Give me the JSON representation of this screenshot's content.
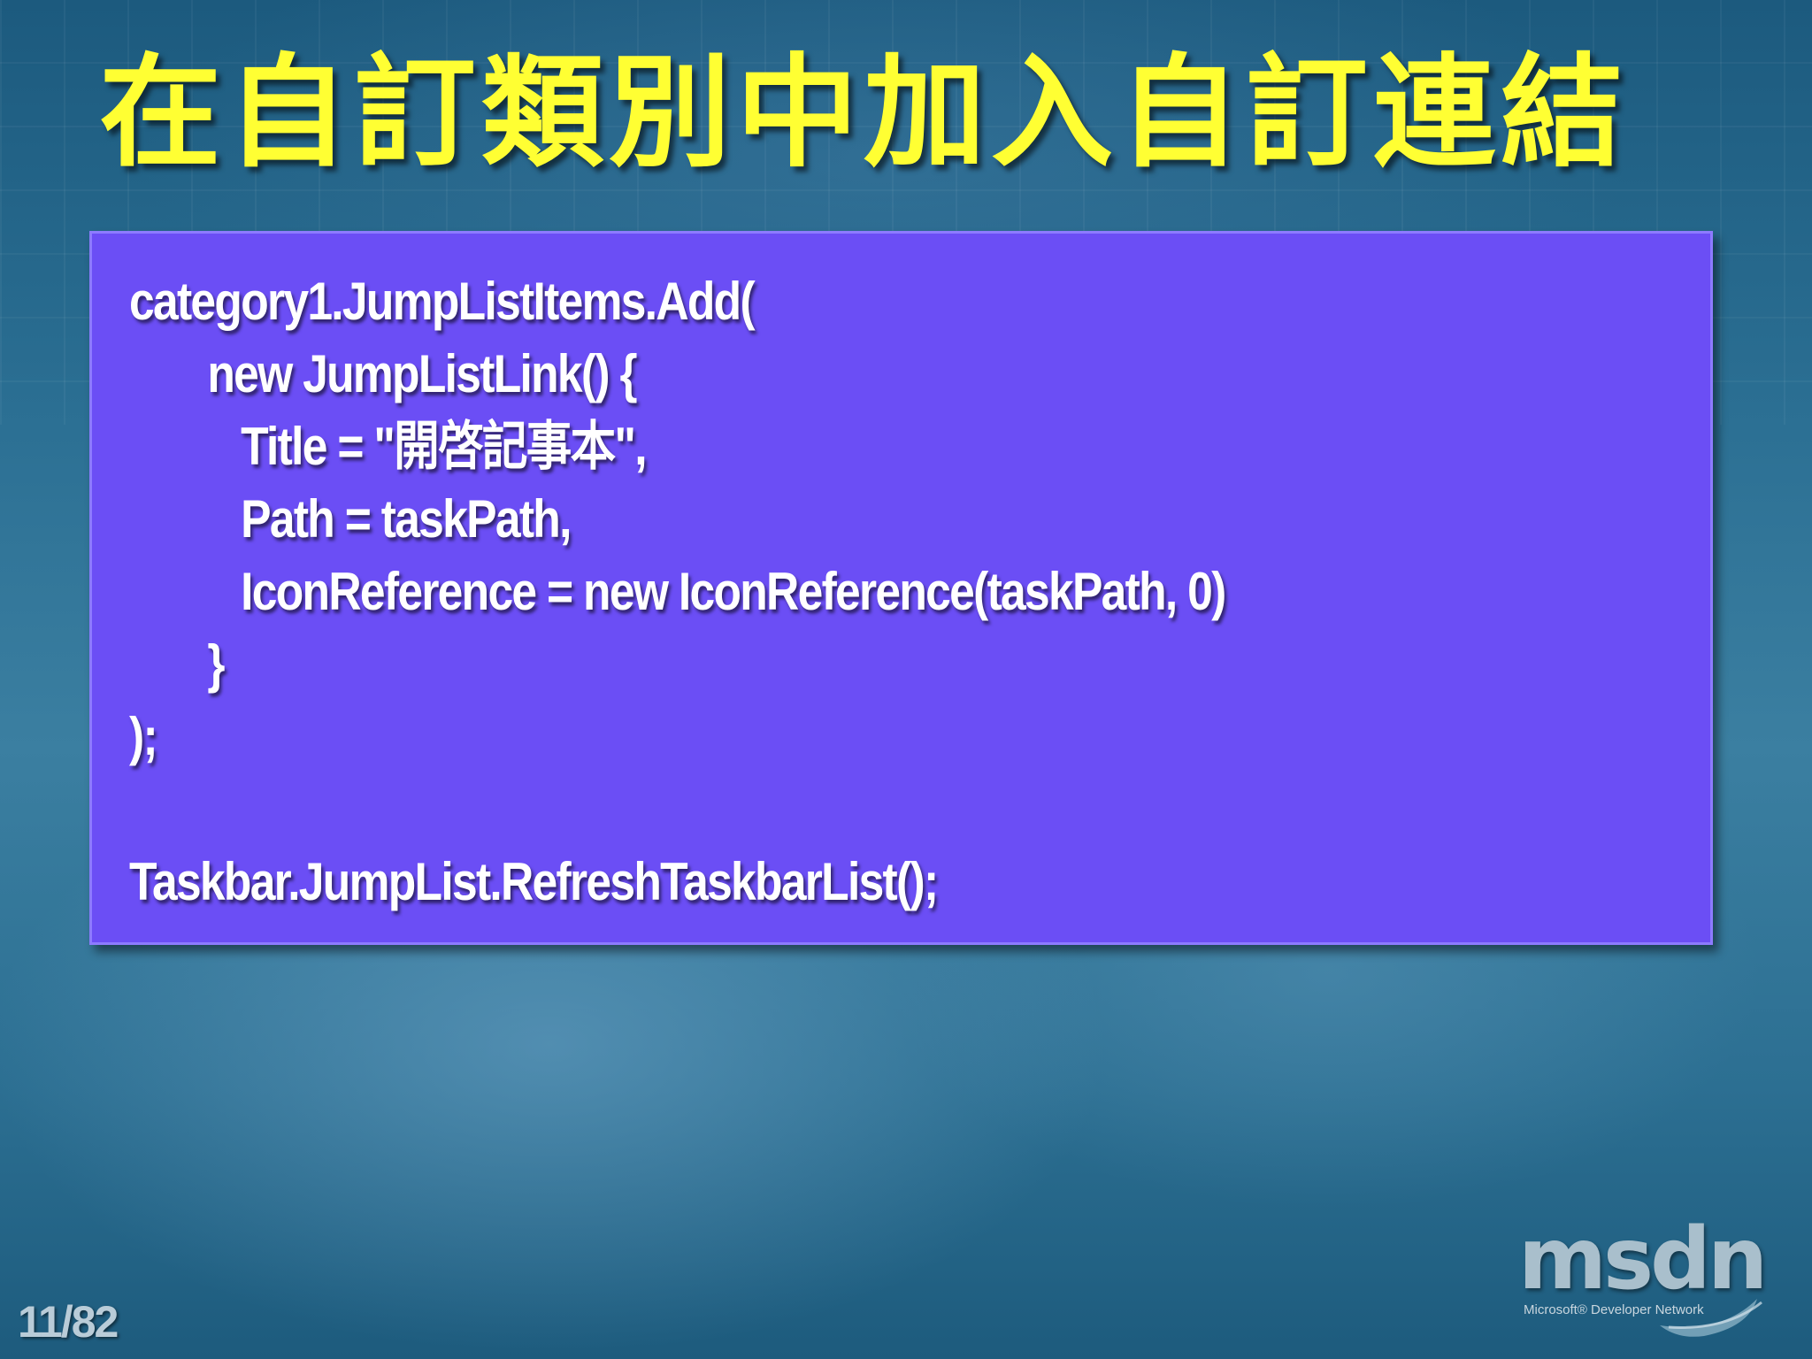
{
  "slide": {
    "title": "在自訂類別中加入自訂連結",
    "code_lines": [
      "category1.JumpListItems.Add(",
      "       new JumpListLink() {",
      "          Title = \"開啓記事本\",",
      "          Path = taskPath,",
      "          IconReference = new IconReference(taskPath, 0)",
      "       }",
      ");",
      "",
      "Taskbar.JumpList.RefreshTaskbarList();"
    ],
    "page_number": "11/82"
  },
  "logo": {
    "text": "msdn",
    "tagline": "Microsoft® Developer Network",
    "icon": "msdn-swoosh-icon"
  },
  "colors": {
    "title": "#ffff33",
    "code_box": "#6b4ef5",
    "code_text": "#ffffff"
  }
}
